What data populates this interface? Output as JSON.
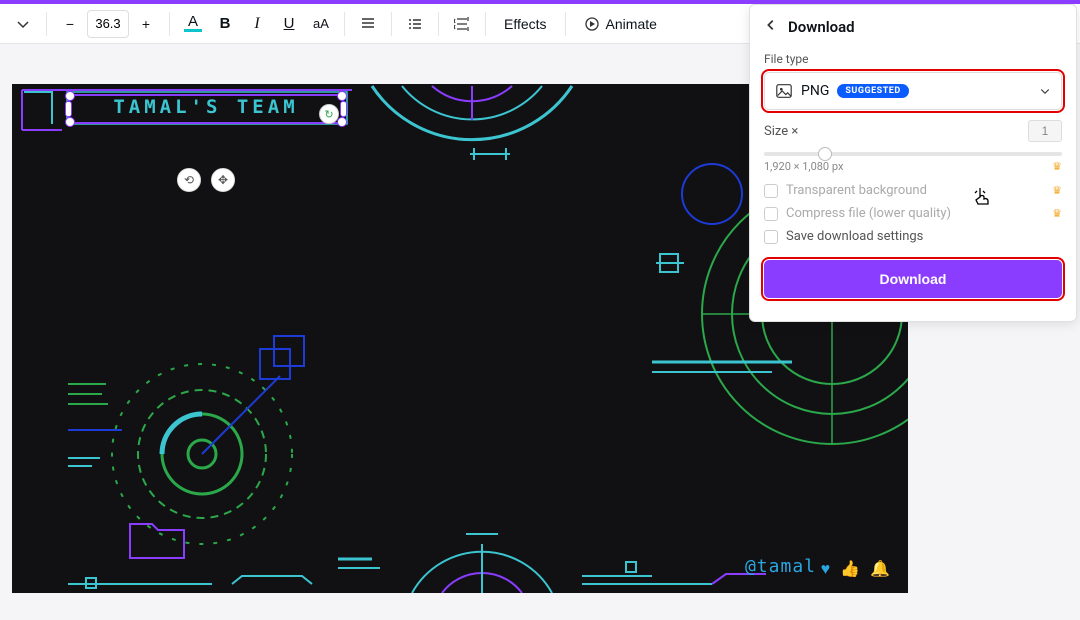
{
  "toolbar": {
    "font_size": "36.3",
    "effects_label": "Effects",
    "animate_label": "Animate",
    "caps_label": "aA",
    "letter_a": "A",
    "bold": "B",
    "italic": "I",
    "underline": "U"
  },
  "canvas": {
    "title_text": "TAMAL'S TEAM",
    "handle_text": "@tamal"
  },
  "panel": {
    "title": "Download",
    "file_type_label": "File type",
    "file_type_value": "PNG",
    "file_type_badge": "SUGGESTED",
    "size_label": "Size ×",
    "size_value": "1",
    "dimensions": "1,920 × 1,080 px",
    "opt_transparent": "Transparent background",
    "opt_compress": "Compress file (lower quality)",
    "opt_save": "Save download settings",
    "download_btn": "Download"
  },
  "icons": {
    "heart": "heart-icon",
    "thumbs": "thumbs-up-icon",
    "bell": "bell-icon",
    "crown": "crown-icon"
  }
}
